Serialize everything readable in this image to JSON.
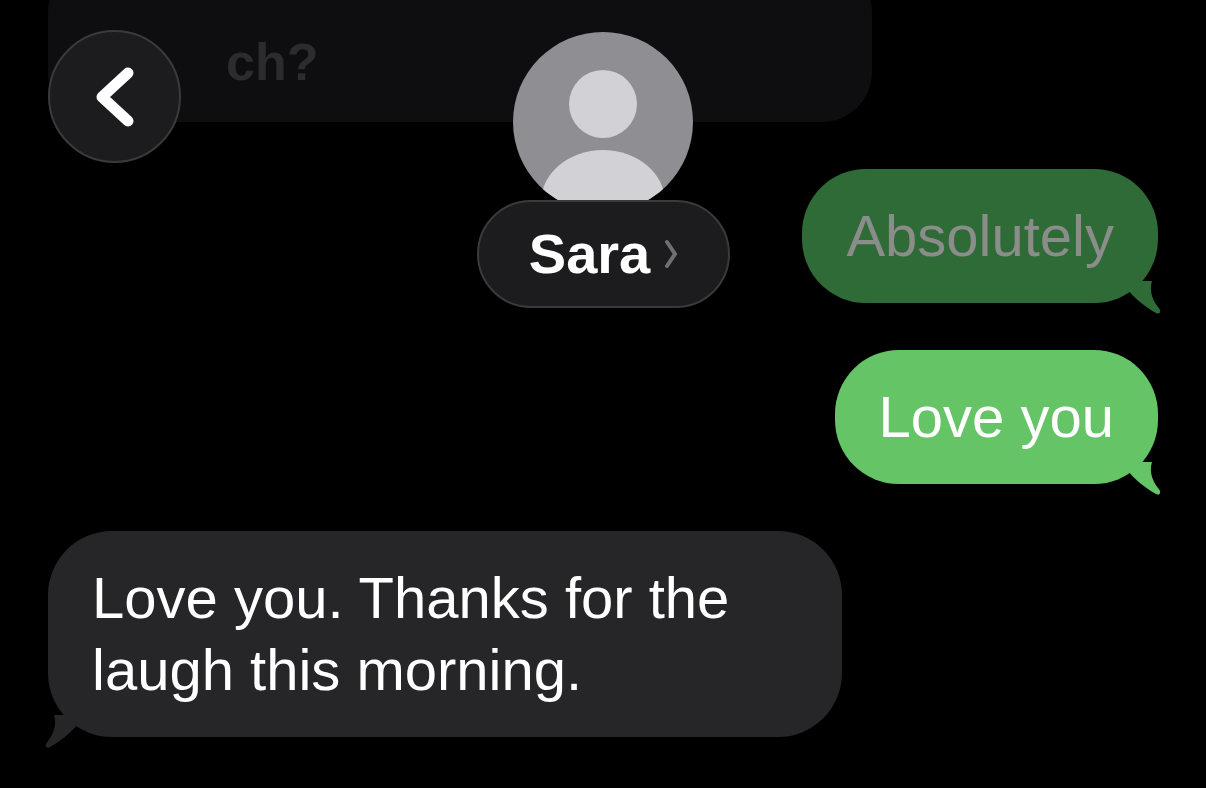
{
  "header": {
    "contact_name": "Sara"
  },
  "messages": [
    {
      "text": "ch?",
      "kind": "incoming",
      "dimmed": true
    },
    {
      "text": "Absolutely",
      "kind": "outgoing",
      "dimmed": true
    },
    {
      "text": "Love you",
      "kind": "outgoing",
      "dimmed": false
    },
    {
      "text": "Love you. Thanks for the laugh this morning.",
      "kind": "incoming",
      "dimmed": false
    }
  ]
}
